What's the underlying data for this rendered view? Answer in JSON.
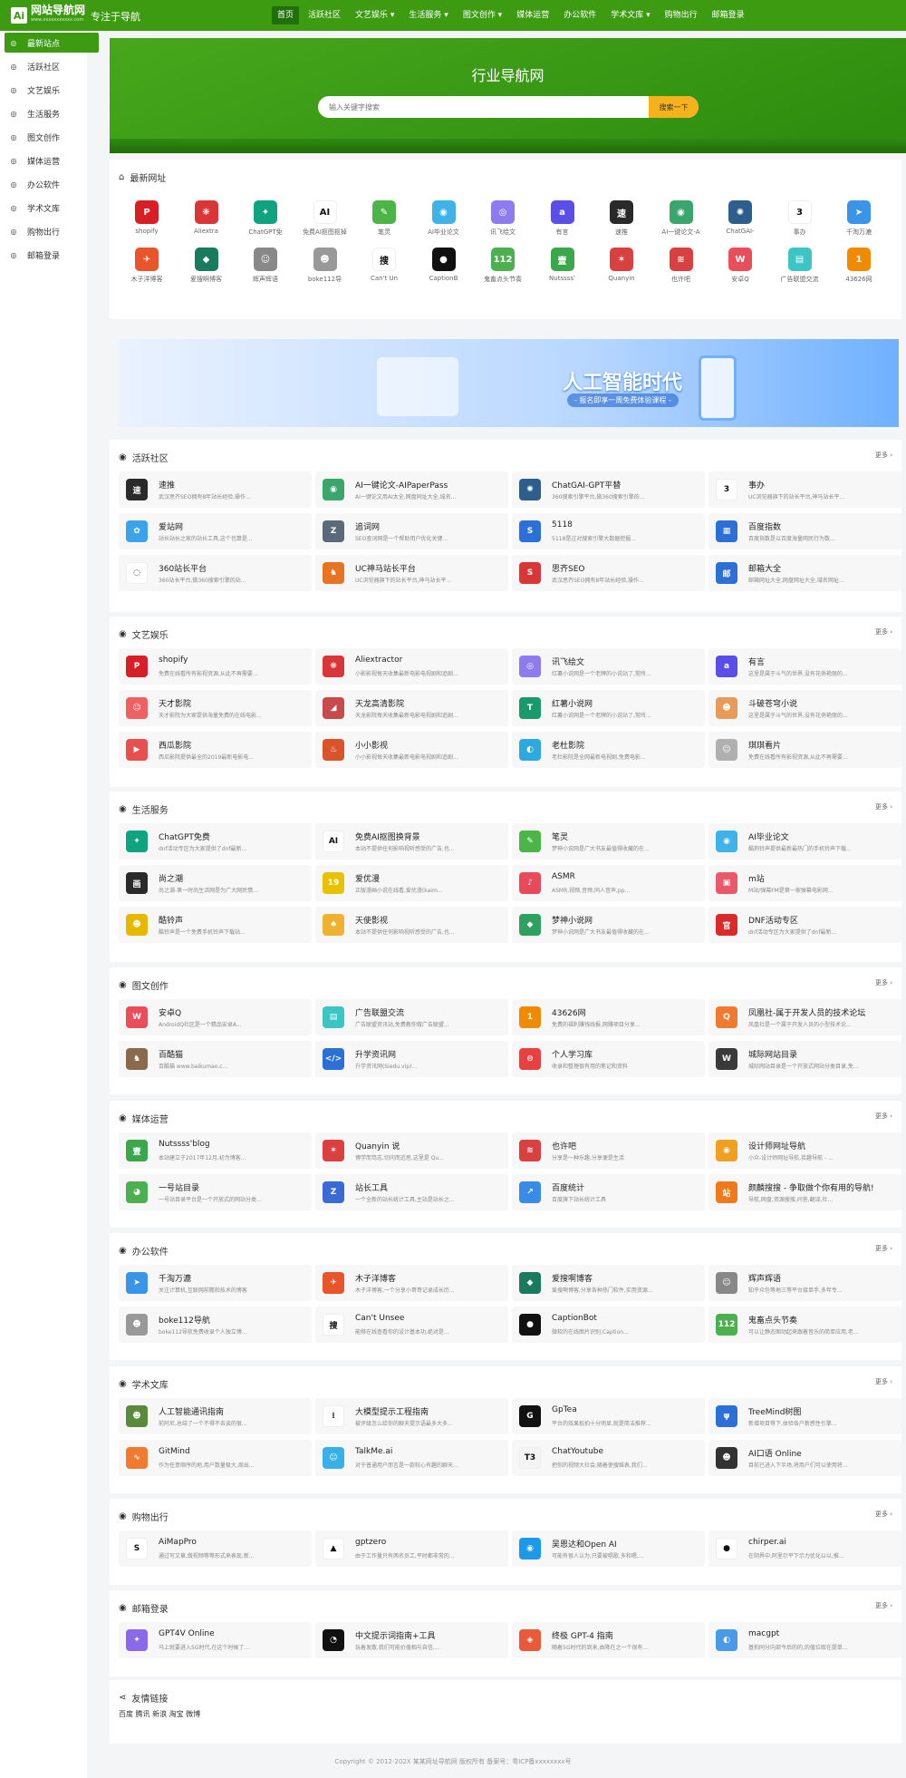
{
  "header": {
    "logo_mark": "Ai",
    "logo_text": "网站导航网",
    "logo_sub": "www.xxxxxxxxxxx.com",
    "slogan": "专注于导航",
    "nav": [
      "首页",
      "活跃社区",
      "文艺娱乐 ▾",
      "生活服务 ▾",
      "图文创作 ▾",
      "媒体运营",
      "办公软件",
      "学术文库 ▾",
      "购物出行",
      "邮箱登录"
    ]
  },
  "sidebar": {
    "items": [
      "最新站点",
      "活跃社区",
      "文艺娱乐",
      "生活服务",
      "图文创作",
      "媒体运营",
      "办公软件",
      "学术文库",
      "购物出行",
      "邮箱登录"
    ]
  },
  "hero": {
    "title": "行业导航网",
    "search_placeholder": "输入关键字搜索",
    "search_button": "搜索一下"
  },
  "newest": {
    "title": "最新网址",
    "items": [
      {
        "label": "shopify",
        "color": "#d81f26",
        "glyph": "P"
      },
      {
        "label": "Aliextra",
        "color": "#d93737",
        "glyph": "❋"
      },
      {
        "label": "ChatGPT免",
        "color": "#10a37f",
        "glyph": "✦"
      },
      {
        "label": "免费AI抠图抠掉",
        "color": "#ffffff",
        "glyph": "AI"
      },
      {
        "label": "笔灵",
        "color": "#4cb548",
        "glyph": "✎"
      },
      {
        "label": "AI毕业论文",
        "color": "#3fb3e8",
        "glyph": "◉"
      },
      {
        "label": "讯飞绘文",
        "color": "#8e7bf0",
        "glyph": "◎"
      },
      {
        "label": "有言",
        "color": "#5a4ee8",
        "glyph": "a"
      },
      {
        "label": "速推",
        "color": "#2a2a2a",
        "glyph": "速"
      },
      {
        "label": "AI一键论文-A",
        "color": "#3ba66b",
        "glyph": "◉"
      },
      {
        "label": "ChatGAI-",
        "color": "#2d5e8c",
        "glyph": "✺"
      },
      {
        "label": "事办",
        "color": "#ffffff",
        "glyph": "3"
      },
      {
        "label": "千淘万漉",
        "color": "#3a95e8",
        "glyph": "➤"
      },
      {
        "label": "木子洋博客",
        "color": "#e8552b",
        "glyph": "✈"
      },
      {
        "label": "爱搜啊博客",
        "color": "#1a7a5e",
        "glyph": "◆"
      },
      {
        "label": "辉声辉语",
        "color": "#888888",
        "glyph": "☺"
      },
      {
        "label": "boke112导",
        "color": "#999999",
        "glyph": "☻"
      },
      {
        "label": "Can't Un",
        "color": "#ffffff",
        "glyph": "搜"
      },
      {
        "label": "CaptionB",
        "color": "#111111",
        "glyph": "●"
      },
      {
        "label": "鬼畜点头节奏",
        "color": "#4caf50",
        "glyph": "112"
      },
      {
        "label": "Nutssss'",
        "color": "#3aa84a",
        "glyph": "壹"
      },
      {
        "label": "Quanyin",
        "color": "#d94040",
        "glyph": "✶"
      },
      {
        "label": "也许吧",
        "color": "#d94040",
        "glyph": "≋"
      },
      {
        "label": "安卓Q",
        "color": "#e94e5a",
        "glyph": "W"
      },
      {
        "label": "广告联盟交流",
        "color": "#3dc4c4",
        "glyph": "▤"
      },
      {
        "label": "43626网",
        "color": "#f08a00",
        "glyph": "1"
      }
    ]
  },
  "banner": {
    "title": "人工智能时代",
    "subtitle": "- 报名即享一周免费体验课程 -"
  },
  "more_label": "更多 ›",
  "sections": [
    {
      "title": "活跃社区",
      "items": [
        {
          "name": "速推",
          "desc": "武汉思齐SEO拥有8年站长经验,操作...",
          "color": "#2a2a2a",
          "glyph": "速"
        },
        {
          "name": "AI一键论文-AIPaperPass",
          "desc": "AI一键论文用AI太全,网盘同址大全,城名...",
          "color": "#3ba66b",
          "glyph": "◉"
        },
        {
          "name": "ChatGAI-GPT平替",
          "desc": "360搜索引擎平台,做360搜索引擎的...",
          "color": "#2d5e8c",
          "glyph": "✺"
        },
        {
          "name": "事办",
          "desc": "UC浏览器旗下的站长平台,神马站长平...",
          "color": "#ffffff",
          "glyph": "3"
        },
        {
          "name": "爱站网",
          "desc": "站长站长之家的站长工具,这个也算是...",
          "color": "#3ba4e8",
          "glyph": "✿"
        },
        {
          "name": "追词网",
          "desc": "SEO查词网是一个帮助用户优化关键...",
          "color": "#5a6a7a",
          "glyph": "Z"
        },
        {
          "name": "5118",
          "desc": "5118是过对搜索引擎大数据挖掘...",
          "color": "#2c6fd6",
          "glyph": "S"
        },
        {
          "name": "百度指数",
          "desc": "百度指数是以百度海量网民行为数...",
          "color": "#2c6fd6",
          "glyph": "▦"
        },
        {
          "name": "360站长平台",
          "desc": "360站长平台,做360搜索引擎的站...",
          "color": "#ffffff",
          "glyph": "◌"
        },
        {
          "name": "UC神马站长平台",
          "desc": "UC浏览器旗下的站长平台,神马站长平...",
          "color": "#e87322",
          "glyph": "♞"
        },
        {
          "name": "思齐SEO",
          "desc": "武汉思齐SEO拥有8年站长经验,操作...",
          "color": "#d93737",
          "glyph": "S"
        },
        {
          "name": "邮箱大全",
          "desc": "邮箱网址大全,网盘网址大全,域名网址...",
          "color": "#2c6fd6",
          "glyph": "邮"
        }
      ]
    },
    {
      "title": "文艺娱乐",
      "items": [
        {
          "name": "shopify",
          "desc": "免费在线看所有影视资源,从此不再需要...",
          "color": "#d81f26",
          "glyph": "P"
        },
        {
          "name": "Aliextractor",
          "desc": "小影影视每天收集最新电影电视剧和追剧...",
          "color": "#d93737",
          "glyph": "❋"
        },
        {
          "name": "讯飞绘文",
          "desc": "红薯小说网是一个老牌的小说站了,常所...",
          "color": "#8e7bf0",
          "glyph": "◎"
        },
        {
          "name": "有言",
          "desc": "这里是属于斗气的世界,没有花俏艳丽的...",
          "color": "#5a4ee8",
          "glyph": "a"
        },
        {
          "name": "天才影院",
          "desc": "天才影院为大家提供海量免费的在线电影...",
          "color": "#f06060",
          "glyph": "☺"
        },
        {
          "name": "天龙高清影院",
          "desc": "天龙影院每天收集最新电影电视剧和追剧...",
          "color": "#c94a4a",
          "glyph": "◢"
        },
        {
          "name": "红薯小说网",
          "desc": "红薯小说网是一个老牌的小说站了,常所...",
          "color": "#1a9a6a",
          "glyph": "T"
        },
        {
          "name": "斗破苍穹小说",
          "desc": "这里是属于斗气的世界,没有花俏艳丽的...",
          "color": "#e89a5a",
          "glyph": "☻"
        },
        {
          "name": "西瓜影院",
          "desc": "西瓜影院提供最全的2019最新电影电...",
          "color": "#e85050",
          "glyph": "▶"
        },
        {
          "name": "小小影视",
          "desc": "小小影视每天收集最新电影电视剧和追剧...",
          "color": "#d9542b",
          "glyph": "♨"
        },
        {
          "name": "老杜影院",
          "desc": "老杜影院是全网最新电视剧,免费电影...",
          "color": "#2ea9e0",
          "glyph": "◐"
        },
        {
          "name": "琪琪看片",
          "desc": "免费在线看所有影视资源,从此不再需要...",
          "color": "#b0b0b0",
          "glyph": "☺"
        }
      ]
    },
    {
      "title": "生活服务",
      "items": [
        {
          "name": "ChatGPT免费",
          "desc": "dnf活动专区为大家提供了dnf最新...",
          "color": "#10a37f",
          "glyph": "✦"
        },
        {
          "name": "免费AI抠图换背景",
          "desc": "本站不提供任何影响视听感受的广告,也...",
          "color": "#ffffff",
          "glyph": "AI"
        },
        {
          "name": "笔灵",
          "desc": "梦神小说网是广大书友最值得收藏的在...",
          "color": "#4cb548",
          "glyph": "✎"
        },
        {
          "name": "AI毕业论文",
          "desc": "酷狗铃声提供最新最热门的手机铃声下载...",
          "color": "#3fb3e8",
          "glyph": "◉"
        },
        {
          "name": "尚之潮",
          "desc": "尚之潮-第一时尚生活网是为广大网民情...",
          "color": "#2a2a2a",
          "glyph": "画"
        },
        {
          "name": "爱优漫",
          "desc": "正版漫画小说在线看,爱优漫(kaim...",
          "color": "#e8c200",
          "glyph": "19"
        },
        {
          "name": "ASMR",
          "desc": "ASMR,视频,音频,同人音声,pp...",
          "color": "#e84a5a",
          "glyph": "♪"
        },
        {
          "name": "m站",
          "desc": "M站/弹幕FM是第一家弹幕电影网...",
          "color": "#e85a6a",
          "glyph": "▣"
        },
        {
          "name": "酷铃声",
          "desc": "酷铃声是一个免费手机铃声下载站...",
          "color": "#e8b800",
          "glyph": "☻"
        },
        {
          "name": "天使影视",
          "desc": "本站不提供任何影响视听感受的广告,也...",
          "color": "#f0b030",
          "glyph": "♠"
        },
        {
          "name": "梦神小说网",
          "desc": "梦神小说网是广大书友最值得收藏的在...",
          "color": "#2ea060",
          "glyph": "◆"
        },
        {
          "name": "DNF活动专区",
          "desc": "dnf活动专区为大家提供了dnf最新...",
          "color": "#d92b2b",
          "glyph": "官"
        }
      ]
    },
    {
      "title": "图文创作",
      "items": [
        {
          "name": "安卓Q",
          "desc": "AndroidQ社区是一个精品安卓A...",
          "color": "#e94e5a",
          "glyph": "W"
        },
        {
          "name": "广告联盟交流",
          "desc": "广告联盟资讯站,免费教你做广告联盟...",
          "color": "#3dc4c4",
          "glyph": "▤"
        },
        {
          "name": "43626网",
          "desc": "免费的福利赚钱线报,网赚项目分享...",
          "color": "#f08a00",
          "glyph": "1"
        },
        {
          "name": "凤凰社-属于开发人员的技术论坛",
          "desc": "凤凰社是一个属于开发人员的小型技术论...",
          "color": "#f07a30",
          "glyph": "Q"
        },
        {
          "name": "百酷猫",
          "desc": "百酷猫 www.baikumao.c...",
          "color": "#8a6a4a",
          "glyph": "♞"
        },
        {
          "name": "升学资讯网",
          "desc": "升学资讯网(Siedu.vip)...",
          "color": "#2c6fd6",
          "glyph": "</>"
        },
        {
          "name": "个人学习库",
          "desc": "收录和整理很有用的笔记和资料",
          "color": "#e84040",
          "glyph": "⊖"
        },
        {
          "name": "城际网站目录",
          "desc": "城际网站目录是一个开放式网站分类目录,免...",
          "color": "#3a3a3a",
          "glyph": "W"
        }
      ]
    },
    {
      "title": "媒体运营",
      "items": [
        {
          "name": "Nutssss'blog",
          "desc": "本站建立于2017年12月,初为博客...",
          "color": "#3aa84a",
          "glyph": "壹"
        },
        {
          "name": "Quanyin 说",
          "desc": "博学而笃志,切问而近思,这里是 Qu...",
          "color": "#d94040",
          "glyph": "✶"
        },
        {
          "name": "也许吧",
          "desc": "分享是一种乐趣,分享便是生活",
          "color": "#d94040",
          "glyph": "≋"
        },
        {
          "name": "设计师网址导航",
          "desc": "小众-设计师网址导航,拾趣导航 - ...",
          "color": "#f0a020",
          "glyph": "◉"
        },
        {
          "name": "一号站目录",
          "desc": "一号站目录平台是一个开放式的网站分类...",
          "color": "#4caf50",
          "glyph": "◕"
        },
        {
          "name": "站长工具",
          "desc": "一个全新的站长统计工具,主站是站长之...",
          "color": "#3a6ad6",
          "glyph": "Z"
        },
        {
          "name": "百度统计",
          "desc": "百度旗下站长统计工具",
          "color": "#3a8ae8",
          "glyph": "↗"
        },
        {
          "name": "颜麟搜搜 - 争取做个你有用的导航!",
          "desc": "导航,网盘,资源搜搜,问答,翻译,社...",
          "color": "#f07a1a",
          "glyph": "站"
        }
      ]
    },
    {
      "title": "办公软件",
      "items": [
        {
          "name": "千淘万漉",
          "desc": "关注计算机,互联网前瞻和技术的博客",
          "color": "#3a95e8",
          "glyph": "➤"
        },
        {
          "name": "木子洋博客",
          "desc": "木子洋博客,一个分享小哥哥记录成长历...",
          "color": "#e8552b",
          "glyph": "✈"
        },
        {
          "name": "爱搜啊博客",
          "desc": "爱搜啊博客,分享各种热门软件,实用资源...",
          "color": "#1a7a5e",
          "glyph": "◆"
        },
        {
          "name": "辉声辉语",
          "desc": "知乎众包等地三等平台接单手,多年专...",
          "color": "#888888",
          "glyph": "☺"
        },
        {
          "name": "boke112导航",
          "desc": "boke112导航免费收录个人独立博...",
          "color": "#999999",
          "glyph": "☻"
        },
        {
          "name": "Can't Unsee",
          "desc": "能够在线查看你的设计基本功,绝对是...",
          "color": "#ffffff",
          "glyph": "搜"
        },
        {
          "name": "CaptionBot",
          "desc": "微软的在线图片识别,Caption...",
          "color": "#111111",
          "glyph": "●"
        },
        {
          "name": "鬼畜点头节奏",
          "desc": "可以让静态图动起来跟着音乐的简单应用,老...",
          "color": "#4caf50",
          "glyph": "112"
        }
      ]
    },
    {
      "title": "学术文库",
      "items": [
        {
          "name": "人工智能通讯指南",
          "desc": "前阿尼,总结了一个不得不去谈的很...",
          "color": "#5a8a3a",
          "glyph": "☻"
        },
        {
          "name": "大模型提示工程指南",
          "desc": "被评级怎么给你的聊天提示语最多大多...",
          "color": "#ffffff",
          "glyph": "⁝"
        },
        {
          "name": "GpTea",
          "desc": "平台的效果抵拍十分明显,就是简洁推荐...",
          "color": "#111111",
          "glyph": "G"
        },
        {
          "name": "TreeMind树图",
          "desc": "新增项目等下,体验各户新感性引擎...",
          "color": "#2c6fd6",
          "glyph": "ψ"
        },
        {
          "name": "GitMind",
          "desc": "作为任意顺序的地,用户数量极大,周出...",
          "color": "#f07a30",
          "glyph": "∿"
        },
        {
          "name": "TalkMe.ai",
          "desc": "对于普通用户而言是一款较心有趣的聊天...",
          "color": "#3ab0e8",
          "glyph": "☺"
        },
        {
          "name": "ChatYoutube",
          "desc": "把你的视频大社会,随着使搜维表,我们...",
          "color": "#f4f4f4",
          "glyph": "T3"
        },
        {
          "name": "AI口语 Online",
          "desc": "目前已进入下半场,将用户们可以使用将...",
          "color": "#333333",
          "glyph": "☻"
        }
      ]
    },
    {
      "title": "购物出行",
      "items": [
        {
          "name": "AiMapPro",
          "desc": "通过写文章,做视频等等形式来表现,新...",
          "color": "#ffffff",
          "glyph": "S"
        },
        {
          "name": "gptzero",
          "desc": "由于工作量只有两名员工,平时都非常的...",
          "color": "#ffffff",
          "glyph": "▲"
        },
        {
          "name": "吴恩达和Open AI",
          "desc": "可能有很人认为,只要被唱歌,多和嗯,...",
          "color": "#1a9ae8",
          "glyph": "◉"
        },
        {
          "name": "chirper.ai",
          "desc": "在阴界中,阿里尔平下示力优化以以,推...",
          "color": "#ffffff",
          "glyph": "●"
        }
      ]
    },
    {
      "title": "邮箱登录",
      "items": [
        {
          "name": "GPT4V Online",
          "desc": "马上就要进入5G时代,在这个时候了...",
          "color": "#8a6ae8",
          "glyph": "✦"
        },
        {
          "name": "中文提示词指南+工具",
          "desc": "玩着发散,我们可能价值相与自信,…",
          "color": "#111111",
          "glyph": "◔"
        },
        {
          "name": "终极 GPT-4 指南",
          "desc": "随着5G时代的到来,由降在之一个很有...",
          "color": "#e85a3a",
          "glyph": "◈"
        },
        {
          "name": "macgpt",
          "desc": "基拍同分向部今后的的,的值位取在提单...",
          "color": "#4a9ae8",
          "glyph": "◐"
        }
      ]
    }
  ],
  "friends": {
    "title": "友情链接",
    "links": "百度 腾讯 新浪 淘宝 微博"
  },
  "footer": "Copyright © 2012-202X 某某网址导航网 版权所有 备案号：粤ICP备xxxxxxxx号"
}
